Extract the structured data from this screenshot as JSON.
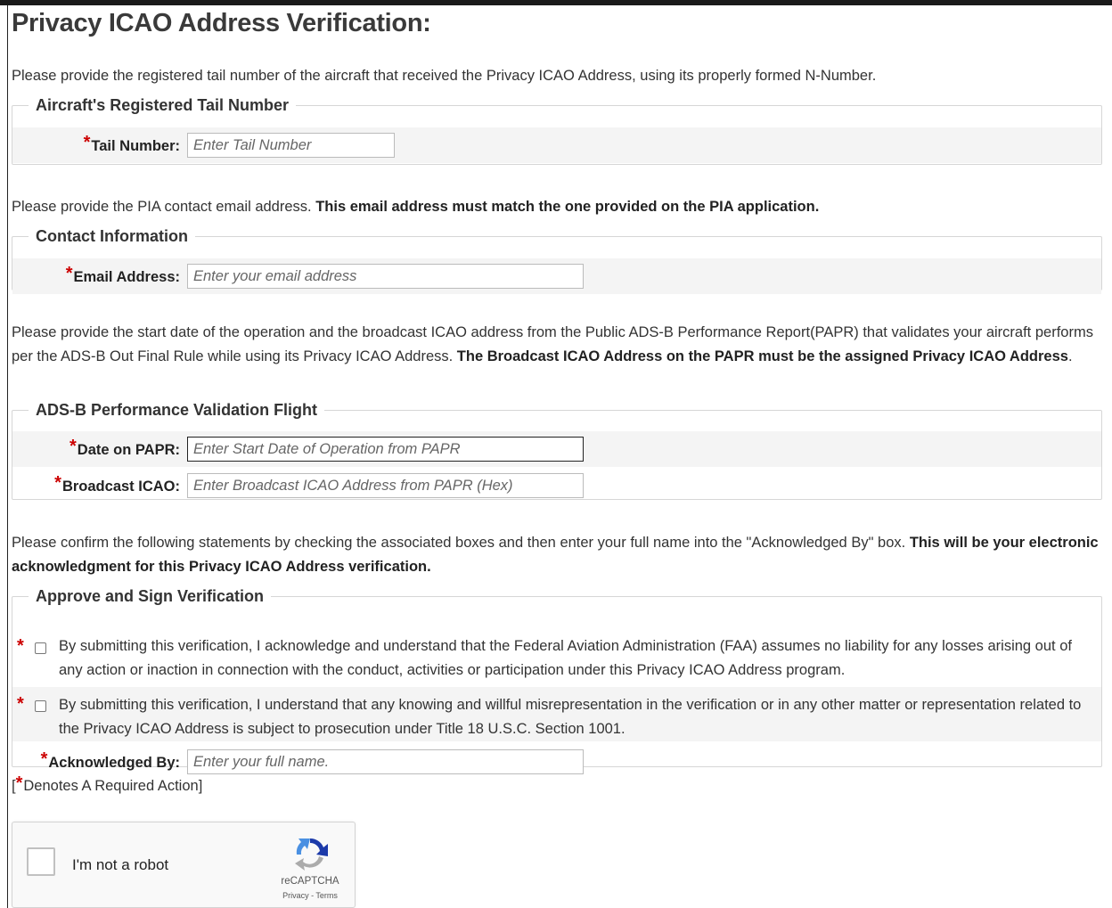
{
  "page": {
    "title": "Privacy ICAO Address Verification:"
  },
  "tail": {
    "intro": "Please provide the registered tail number of the aircraft that received the Privacy ICAO Address, using its properly formed N-Number.",
    "legend": "Aircraft's Registered Tail Number",
    "field_label": "Tail Number:",
    "placeholder": "Enter Tail Number"
  },
  "contact": {
    "intro": "Please provide the PIA contact email address.",
    "intro_bold": "This email address must match the one provided on the PIA application.",
    "legend": "Contact Information",
    "field_label": "Email Address:",
    "placeholder": "Enter your email address"
  },
  "adsb": {
    "intro": "Please provide the start date of the operation and the broadcast ICAO address from the Public ADS-B Performance Report(PAPR) that validates your aircraft performs per the ADS-B Out Final Rule while using its Privacy ICAO Address.",
    "intro_bold": "The Broadcast ICAO Address on the PAPR must be the assigned Privacy ICAO Address",
    "intro_end": ".",
    "legend": "ADS-B Performance Validation Flight",
    "date_label": "Date on PAPR:",
    "date_placeholder": "Enter Start Date of Operation from PAPR",
    "icao_label": "Broadcast ICAO:",
    "icao_placeholder": "Enter Broadcast ICAO Address from PAPR (Hex)"
  },
  "approve": {
    "intro": "Please confirm the following statements by checking the associated boxes and then enter your full name into the \"Acknowledged By\" box.",
    "intro_bold": "This will be your electronic acknowledgment for this Privacy ICAO Address verification.",
    "legend": "Approve and Sign Verification",
    "statement1": "By submitting this verification, I acknowledge and understand that the Federal Aviation Administration (FAA) assumes no liability for any losses arising out of any action or inaction in connection with the conduct, activities or participation under this Privacy ICAO Address program.",
    "statement2": "By submitting this verification, I understand that any knowing and willful misrepresentation in the verification or in any other matter or representation related to the Privacy ICAO Address is subject to prosecution under Title 18 U.S.C. Section 1001.",
    "ack_label": "Acknowledged By:",
    "ack_placeholder": "Enter your full name."
  },
  "required": {
    "star": "*",
    "open": "[",
    "note": "Denotes A Required Action]"
  },
  "recaptcha": {
    "label": "I'm not a robot",
    "brand": "reCAPTCHA",
    "links": "Privacy - Terms",
    "icon": "recaptcha-logo-icon"
  },
  "colors": {
    "required": "#cc0000",
    "fieldset_bg": "#f4f4f4"
  }
}
